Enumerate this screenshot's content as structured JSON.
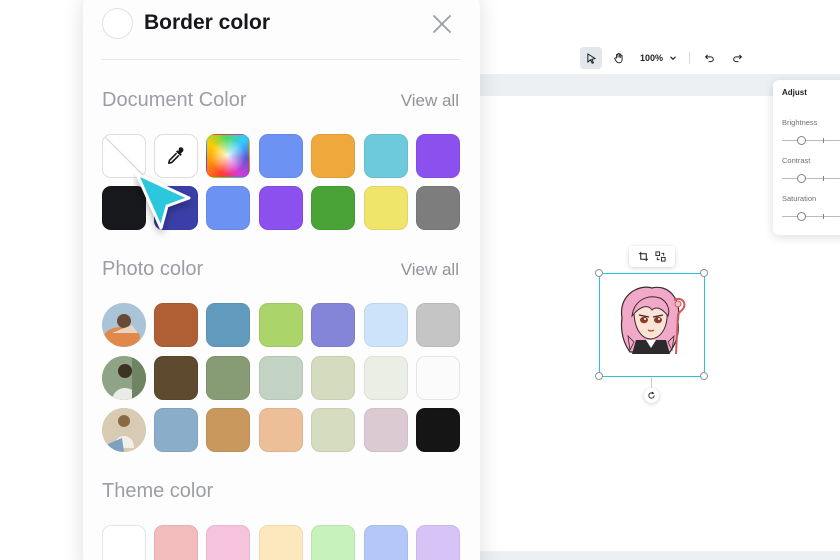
{
  "popover": {
    "title": "Border color",
    "sections": {
      "document": {
        "title": "Document Color",
        "view_all": "View all"
      },
      "photo": {
        "title": "Photo color",
        "view_all": "View all"
      },
      "theme": {
        "title": "Theme color"
      }
    },
    "document_colors": [
      [
        "none",
        "eyedropper",
        "gradient",
        "#6c92f4",
        "#eea83b",
        "#6ccadc",
        "#8b50ee"
      ],
      [
        "#17181c",
        "#3a3fa8",
        "#6c92f4",
        "#8b50ee",
        "#4aa336",
        "#efe56a",
        "#7d7d7d"
      ]
    ],
    "photo_colors": [
      [
        "photo-1",
        "#b05e33",
        "#609bbd",
        "#abd46b",
        "#8484d9",
        "#cde3fa",
        "#c5c5c5"
      ],
      [
        "photo-2",
        "#5e4a2e",
        "#879b74",
        "#c2d3c3",
        "#d5dbbe",
        "#eaeee4",
        "#fbfbfb"
      ],
      [
        "photo-3",
        "#8aadca",
        "#c8985c",
        "#ecbf98",
        "#d6dcc0",
        "#dccad3",
        "#151515"
      ]
    ],
    "theme_colors": [
      "#ffffff",
      "#f3bcbc",
      "#f6c3dc",
      "#fde8bd",
      "#c7f2bb",
      "#b3c7f8",
      "#d7c3f6"
    ]
  },
  "toolbar": {
    "zoom": "100%"
  },
  "adjust_panel": {
    "title": "Adjust",
    "sliders": [
      {
        "label": "Brightness"
      },
      {
        "label": "Contrast"
      },
      {
        "label": "Saturation"
      }
    ]
  },
  "colors": {
    "selection": "#29c2dc",
    "cursor": "#2bc7dd"
  }
}
